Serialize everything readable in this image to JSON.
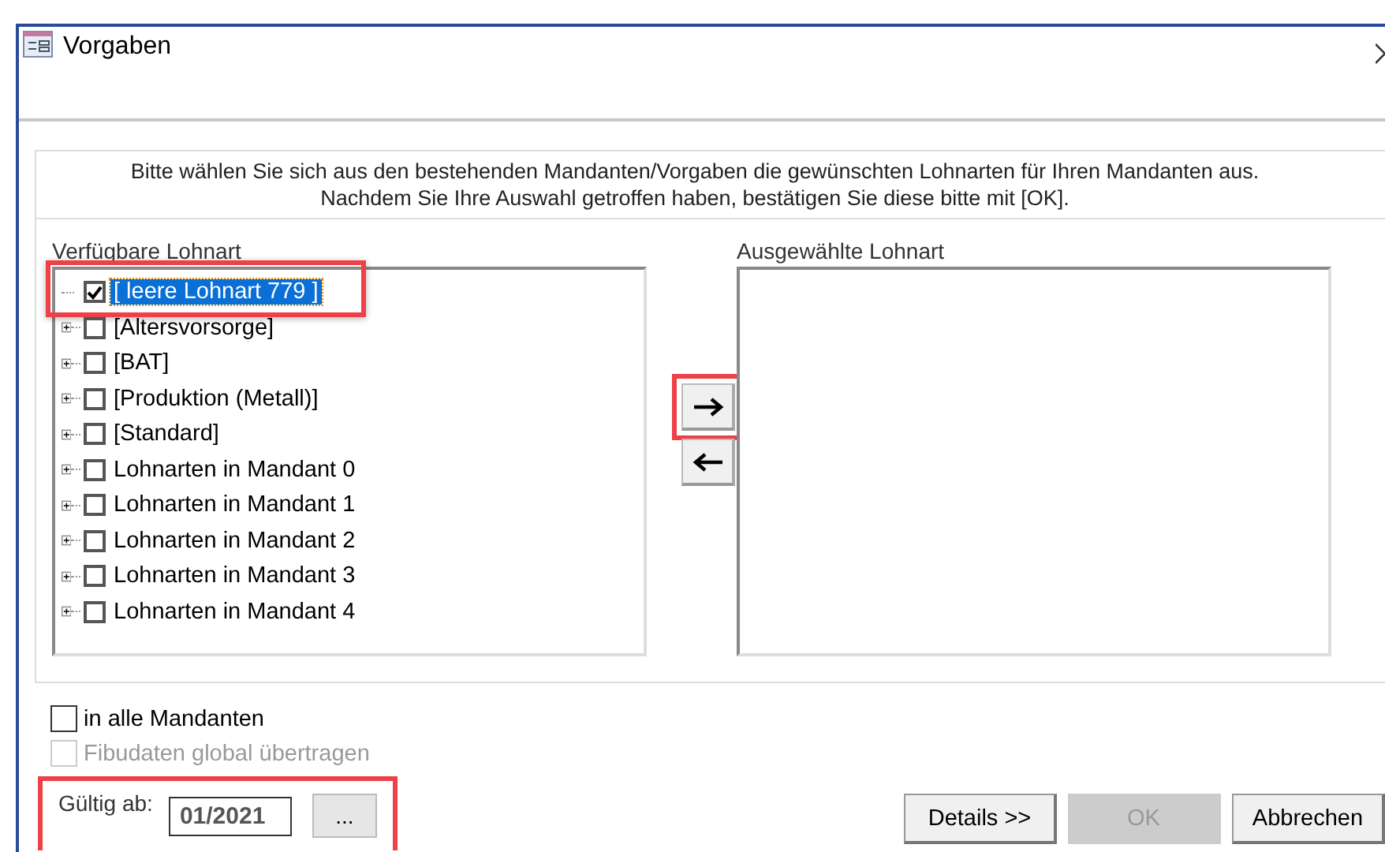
{
  "window": {
    "title": "Vorgaben"
  },
  "instructions": [
    "Bitte wählen Sie sich aus den bestehenden Mandanten/Vorgaben die gewünschten Lohnarten für Ihren Mandanten aus.",
    "Nachdem Sie Ihre Auswahl getroffen haben, bestätigen Sie diese bitte mit [OK]."
  ],
  "available": {
    "label": "Verfügbare Lohnart",
    "items": [
      {
        "label": "[ leere Lohnart 779 ]",
        "checked": true,
        "selected": true,
        "expandable": false,
        "highlighted": true
      },
      {
        "label": "[Altersvorsorge]",
        "checked": false,
        "selected": false,
        "expandable": true,
        "highlighted": false
      },
      {
        "label": "[BAT]",
        "checked": false,
        "selected": false,
        "expandable": true,
        "highlighted": false
      },
      {
        "label": "[Produktion (Metall)]",
        "checked": false,
        "selected": false,
        "expandable": true,
        "highlighted": false
      },
      {
        "label": "[Standard]",
        "checked": false,
        "selected": false,
        "expandable": true,
        "highlighted": false
      },
      {
        "label": "Lohnarten in Mandant 0",
        "checked": false,
        "selected": false,
        "expandable": true,
        "highlighted": false
      },
      {
        "label": "Lohnarten in Mandant 1",
        "checked": false,
        "selected": false,
        "expandable": true,
        "highlighted": false
      },
      {
        "label": "Lohnarten in Mandant 2",
        "checked": false,
        "selected": false,
        "expandable": true,
        "highlighted": false
      },
      {
        "label": "Lohnarten in Mandant 3",
        "checked": false,
        "selected": false,
        "expandable": true,
        "highlighted": false
      },
      {
        "label": "Lohnarten in Mandant 4",
        "checked": false,
        "selected": false,
        "expandable": true,
        "highlighted": false
      }
    ]
  },
  "move_buttons": [
    {
      "kind": "right",
      "highlighted": true
    },
    {
      "kind": "left",
      "highlighted": false
    }
  ],
  "selected_list": {
    "label": "Ausgewählte Lohnart"
  },
  "options": [
    {
      "label": "in alle Mandanten",
      "checked": false,
      "disabled": false
    },
    {
      "label": "Fibudaten global übertragen",
      "checked": false,
      "disabled": true
    }
  ],
  "valid_from": {
    "label": "Gültig ab:",
    "value": "01/2021",
    "button": "...",
    "highlighted": true
  },
  "buttons": [
    {
      "label": "Details >>",
      "disabled": false
    },
    {
      "label": "OK",
      "disabled": true
    },
    {
      "label": "Abbrechen",
      "disabled": false
    }
  ]
}
